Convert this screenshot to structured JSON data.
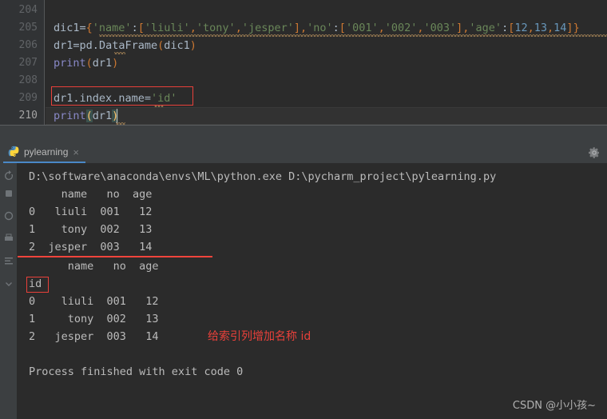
{
  "editor": {
    "line_numbers": [
      "204",
      "205",
      "206",
      "207",
      "208",
      "209",
      "210"
    ],
    "current_line_number": "210",
    "lines": [
      {
        "n": "204",
        "text": ""
      },
      {
        "n": "205",
        "text": "dic1={'name':['liuli','tony','jesper'],'no':['001','002','003'],'age':[12,13,14]}"
      },
      {
        "n": "206",
        "text": "dr1=pd.DataFrame(dic1)"
      },
      {
        "n": "207",
        "text": "print(dr1)"
      },
      {
        "n": "208",
        "text": ""
      },
      {
        "n": "209",
        "text": "dr1.index.name='id'"
      },
      {
        "n": "210",
        "text": "print(dr1)"
      }
    ],
    "line205_tokens": {
      "var": "dic1",
      "eq": "=",
      "open_brace": "{",
      "key_name": "'name'",
      "colon1": ":",
      "list1_open": "[",
      "v1": "'liuli'",
      "c1": ",",
      "v2": "'tony'",
      "c2": ",",
      "v3": "'jesper'",
      "list1_close": "]",
      "c3": ",",
      "key_no": "'no'",
      "colon2": ":",
      "list2_open": "[",
      "n1": "'001'",
      "c4": ",",
      "n2": "'002'",
      "c5": ",",
      "n3": "'003'",
      "list2_close": "]",
      "c6": ",",
      "key_age": "'age'",
      "colon3": ":",
      "list3_open": "[",
      "a1": "12",
      "c7": ",",
      "a2": "13",
      "c8": ",",
      "a3": "14",
      "list3_close": "]",
      "close_brace": "}"
    },
    "line206_tokens": {
      "var": "dr1",
      "eq": "=",
      "mod": "pd",
      "dot": ".",
      "fn": "DataFrame",
      "open": "(",
      "arg": "dic1",
      "close": ")"
    },
    "line207_tokens": {
      "fn": "print",
      "open": "(",
      "arg": "dr1",
      "close": ")"
    },
    "line209_tokens": {
      "obj": "dr1",
      "dot1": ".",
      "attr1": "index",
      "dot2": ".",
      "attr2": "name",
      "eq": "=",
      "val": "'id'"
    },
    "line210_tokens": {
      "fn": "print",
      "open": "(",
      "arg": "dr1",
      "close": ")"
    }
  },
  "tool_window": {
    "tab_label": "pylearning",
    "tab_close_glyph": "×",
    "python_icon": "python-icon",
    "gear_icon": "gear-icon",
    "sidebar_icons": [
      "rerun-icon",
      "stop-icon",
      "trace-icon",
      "print-icon",
      "soft-wrap-icon",
      "scroll-to-end-icon"
    ]
  },
  "console": {
    "command_line": "D:\\software\\anaconda\\envs\\ML\\python.exe D:\\pycharm_project\\pylearning.py",
    "dataframe_1": {
      "header": "     name   no  age",
      "rows": [
        "0   liuli  001   12",
        "1    tony  002   13",
        "2  jesper  003   14"
      ]
    },
    "dataframe_2": {
      "header": "      name   no  age",
      "index_name": "id",
      "rows": [
        "0    liuli  001   12",
        "1     tony  002   13",
        "2   jesper  003   14"
      ]
    },
    "exit_message": "Process finished with exit code 0"
  },
  "annotations": {
    "note_text": "给索引列增加名称 id",
    "watermark": "CSDN @小小孩~",
    "highlight_color": "#e8403a"
  }
}
